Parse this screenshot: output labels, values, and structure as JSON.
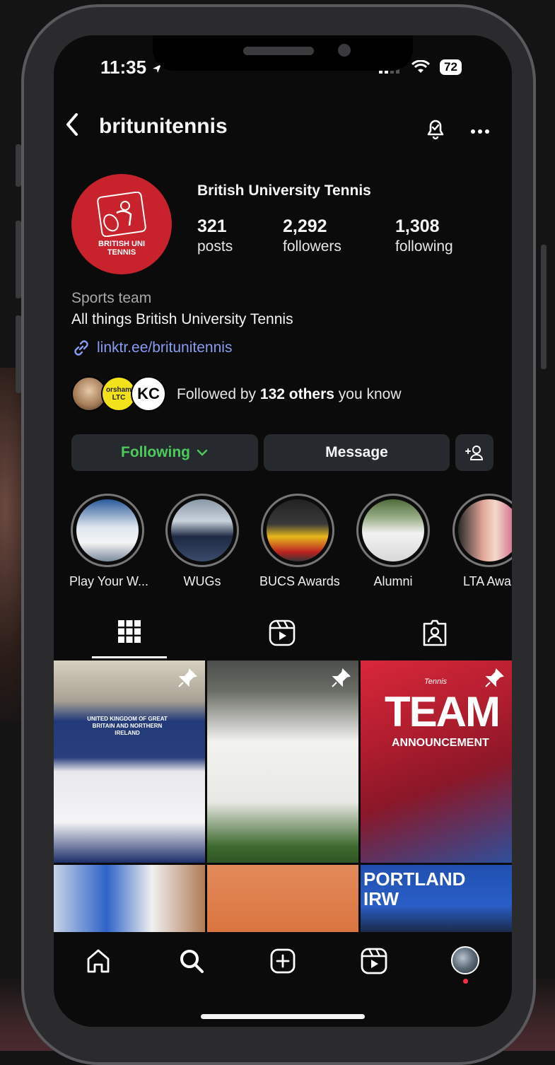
{
  "status": {
    "time": "11:35",
    "battery": "72"
  },
  "header": {
    "username": "britunitennis"
  },
  "profile": {
    "avatar_text": "BRITISH UNI TENNIS",
    "full_name": "British University Tennis",
    "stats": [
      {
        "value": "321",
        "label": "posts"
      },
      {
        "value": "2,292",
        "label": "followers"
      },
      {
        "value": "1,308",
        "label": "following"
      }
    ],
    "category": "Sports team",
    "bio": "All things British University Tennis",
    "link": "linktr.ee/britunitennis"
  },
  "followed_by": {
    "prefix": "Followed by ",
    "count": "132 others",
    "suffix": " you know",
    "avatar_labels": [
      "orsham LTC",
      "KC"
    ]
  },
  "actions": {
    "following_label": "Following",
    "message_label": "Message"
  },
  "highlights": [
    {
      "label": "Play Your W..."
    },
    {
      "label": "WUGs"
    },
    {
      "label": "BUCS Awards"
    },
    {
      "label": "Alumni"
    },
    {
      "label": "LTA Awar"
    }
  ],
  "posts": {
    "post1_sign": "UNITED KINGDOM OF GREAT BRITAIN AND NORTHERN IRELAND",
    "post3_kicker": "Tennis",
    "post3_title": "TEAM",
    "post3_subtitle": "ANNOUNCEMENT",
    "post6_sign": "PORTLAND IRW"
  },
  "colors": {
    "accent_green": "#4ccb5c",
    "link_blue": "#8a9bf2",
    "brand_red": "#c8232c"
  }
}
